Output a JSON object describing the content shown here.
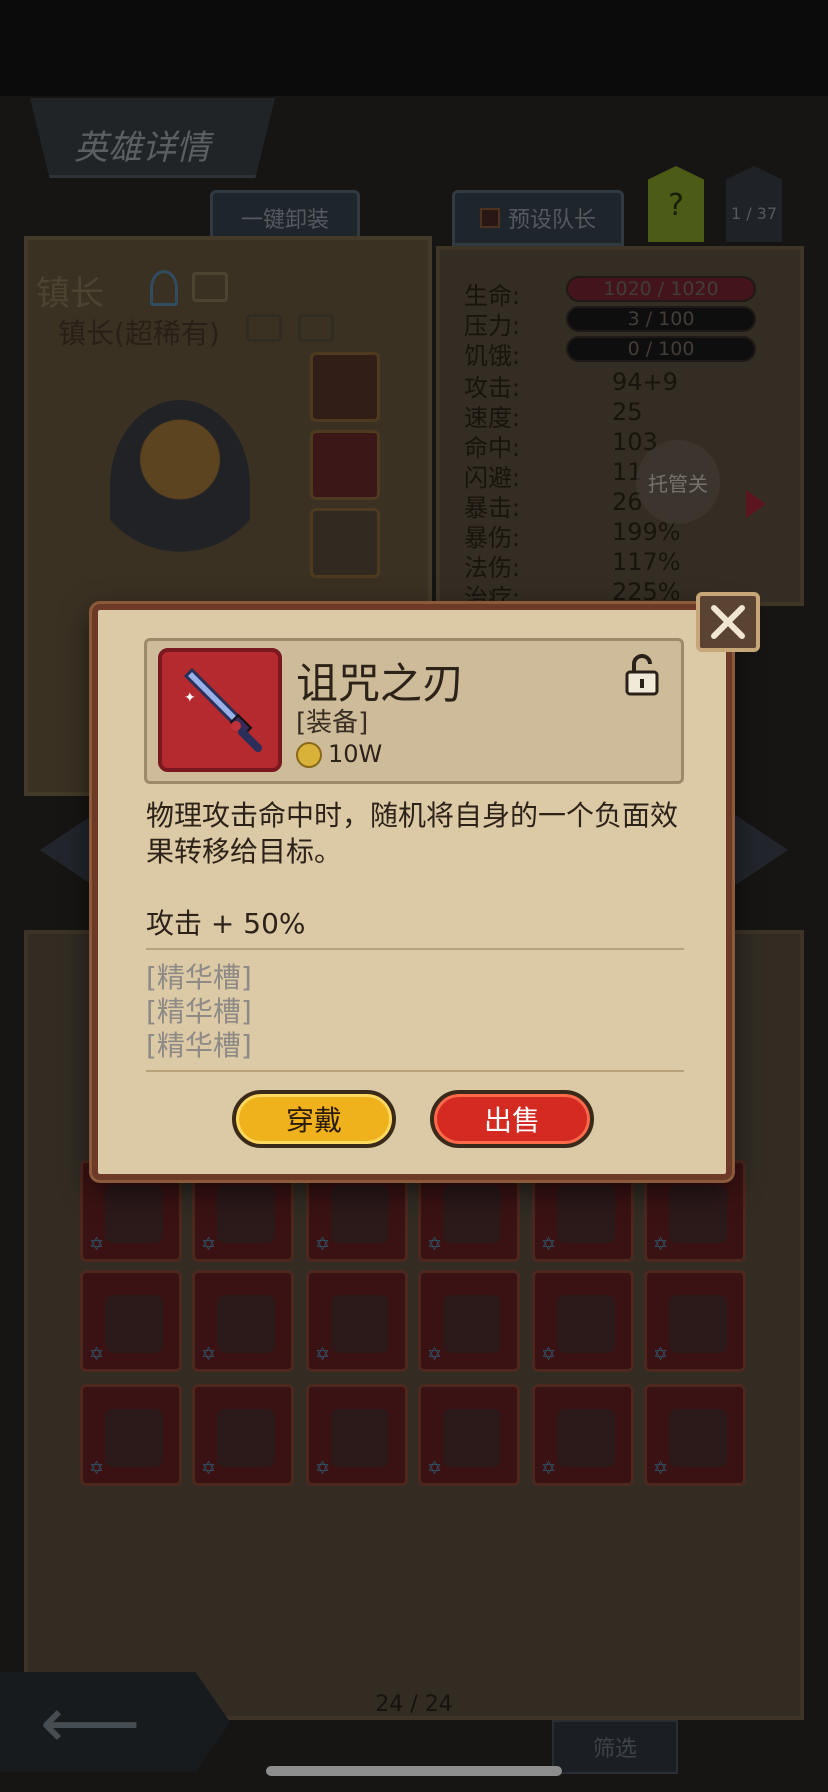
{
  "header": {
    "title": "英雄详情",
    "unequip_all": "一键卸装",
    "preset_leader": "预设队长",
    "help": "?",
    "page_count": "1 / 37"
  },
  "hero": {
    "name": "镇长",
    "rarity": "镇长(超稀有)"
  },
  "stats": [
    {
      "label": "生命:",
      "value": "1020 / 1020",
      "kind": "bar-red"
    },
    {
      "label": "压力:",
      "value": "3 / 100",
      "kind": "bar"
    },
    {
      "label": "饥饿:",
      "value": "0 / 100",
      "kind": "bar"
    },
    {
      "label": "攻击:",
      "value": "94+9",
      "kind": "text"
    },
    {
      "label": "速度:",
      "value": "25",
      "kind": "text"
    },
    {
      "label": "命中:",
      "value": "103",
      "kind": "text"
    },
    {
      "label": "闪避:",
      "value": "11",
      "kind": "text"
    },
    {
      "label": "暴击:",
      "value": "26",
      "kind": "text"
    },
    {
      "label": "暴伤:",
      "value": "199%",
      "kind": "text"
    },
    {
      "label": "法伤:",
      "value": "117%",
      "kind": "text"
    },
    {
      "label": "治疗:",
      "value": "225%",
      "kind": "text"
    }
  ],
  "auto_button": "托管关",
  "inventory": {
    "page_indicator": "24 / 24",
    "filter_label": "筛选"
  },
  "modal": {
    "item_name": "诅咒之刃",
    "item_type": "[装备]",
    "price": "10W",
    "description": "物理攻击命中时，随机将自身的一个负面效果转移给目标。",
    "stat_bonus": "攻击 + 50%",
    "slots": [
      "[精华槽]",
      "[精华槽]",
      "[精华槽]"
    ],
    "equip_label": "穿戴",
    "sell_label": "出售"
  },
  "colors": {
    "equip_button": "#f0b21c",
    "sell_button": "#d42a22",
    "modal_bg": "#dcc9a6",
    "item_bg": "#b42a2e"
  }
}
